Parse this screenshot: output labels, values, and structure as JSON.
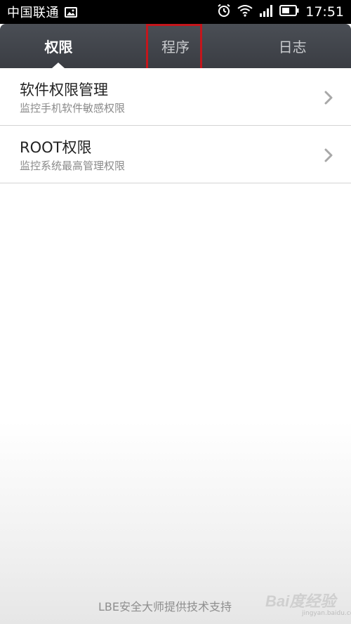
{
  "status_bar": {
    "carrier": "中国联通",
    "time": "17:51",
    "icons": [
      "gallery-icon",
      "alarm-icon",
      "wifi-icon",
      "signal-icon",
      "battery-icon"
    ]
  },
  "tabs": [
    {
      "label": "权限",
      "active": true
    },
    {
      "label": "程序",
      "active": false
    },
    {
      "label": "日志",
      "active": false
    }
  ],
  "list": [
    {
      "title": "软件权限管理",
      "subtitle": "监控手机软件敏感权限"
    },
    {
      "title": "ROOT权限",
      "subtitle": "监控系统最高管理权限"
    }
  ],
  "footer": {
    "text": "LBE安全大师提供技术支持"
  },
  "watermark": {
    "main": "Bai度经验",
    "sub": "jingyan.baidu.com"
  },
  "colors": {
    "tab_bar": "#3f4248",
    "highlight": "#c4161c"
  }
}
